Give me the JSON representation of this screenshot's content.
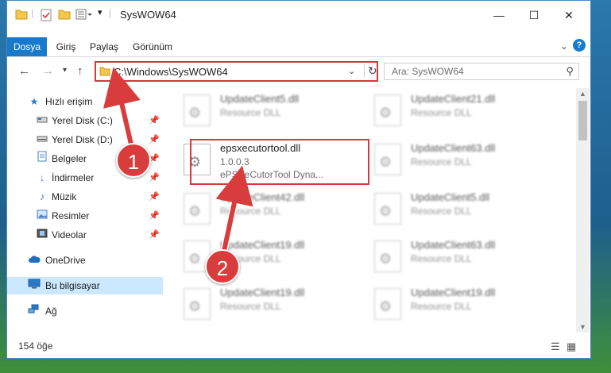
{
  "window": {
    "title": "SysWOW64",
    "controls": {
      "minimize": "—",
      "maximize": "☐",
      "close": "✕"
    }
  },
  "ribbon": {
    "tabs": [
      "Dosya",
      "Giriş",
      "Paylaş",
      "Görünüm"
    ],
    "help": "?"
  },
  "address": {
    "path": "C:\\Windows\\SysWOW64"
  },
  "search": {
    "placeholder": "Ara: SysWOW64"
  },
  "nav": {
    "items": [
      {
        "label": "Hızlı erişim",
        "icon": "star-icon",
        "pinned": false
      },
      {
        "label": "Yerel Disk (C:)",
        "icon": "drive-icon",
        "pinned": true
      },
      {
        "label": "Yerel Disk (D:)",
        "icon": "drive-icon",
        "pinned": true
      },
      {
        "label": "Belgeler",
        "icon": "documents-icon",
        "pinned": true
      },
      {
        "label": "İndirmeler",
        "icon": "download-icon",
        "pinned": true
      },
      {
        "label": "Müzik",
        "icon": "music-icon",
        "pinned": true
      },
      {
        "label": "Resimler",
        "icon": "pictures-icon",
        "pinned": true
      },
      {
        "label": "Videolar",
        "icon": "videos-icon",
        "pinned": true
      },
      {
        "label": "OneDrive",
        "icon": "cloud-icon",
        "pinned": false
      },
      {
        "label": "Bu bilgisayar",
        "icon": "computer-icon",
        "pinned": false
      },
      {
        "label": "Ağ",
        "icon": "network-icon",
        "pinned": false
      }
    ]
  },
  "files": {
    "left": [
      {
        "name": "UpdateClient5.dll",
        "desc": "Resource DLL"
      },
      {
        "name": "epsxecutortool.dll",
        "version": "1.0.0.3",
        "desc": "ePSXeCutorTool Dyna..."
      },
      {
        "name": "UpdateClient42.dll",
        "desc": "Resource DLL"
      },
      {
        "name": "UpdateClient19.dll",
        "desc": "Resource DLL"
      },
      {
        "name": "UpdateClient19.dll",
        "desc": "Resource DLL"
      }
    ],
    "right": [
      {
        "name": "UpdateClient21.dll",
        "desc": "Resource DLL"
      },
      {
        "name": "UpdateClient63.dll",
        "desc": "Resource DLL"
      },
      {
        "name": "UpdateClient5.dll",
        "desc": "Resource DLL"
      },
      {
        "name": "UpdateClient63.dll",
        "desc": "Resource DLL"
      },
      {
        "name": "UpdateClient19.dll",
        "desc": "Resource DLL"
      }
    ]
  },
  "status": {
    "count": "154 öğe"
  },
  "annotations": {
    "badge1": "1",
    "badge2": "2",
    "color": "#d83c3c"
  },
  "colors": {
    "accent": "#1979ca",
    "highlight": "#d9363e",
    "selected": "#cce8ff"
  }
}
